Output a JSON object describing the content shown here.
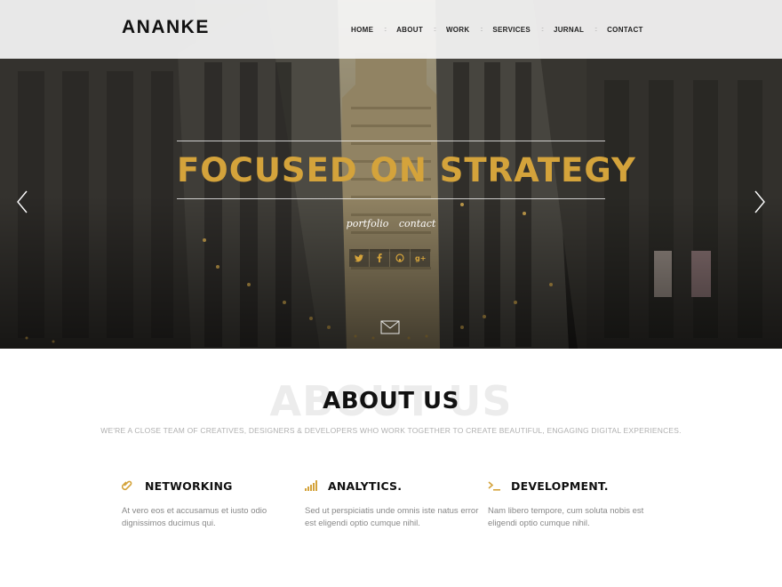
{
  "header": {
    "logo": "ANANKE",
    "nav": [
      {
        "label": "HOME"
      },
      {
        "label": "ABOUT"
      },
      {
        "label": "WORK"
      },
      {
        "label": "SERVICES"
      },
      {
        "label": "JURNAL"
      },
      {
        "label": "CONTACT"
      }
    ],
    "separator": "::"
  },
  "hero": {
    "title": "FOCUSED ON STRATEGY",
    "links": [
      "portfolio",
      "contact"
    ],
    "socials": [
      {
        "icon": "twitter-icon"
      },
      {
        "icon": "facebook-icon"
      },
      {
        "icon": "github-icon"
      },
      {
        "icon": "google-plus-icon"
      }
    ],
    "accent": "#d4a33b"
  },
  "about": {
    "ghost": "ABOUT US",
    "title": "ABOUT US",
    "subtitle": "WE'RE A CLOSE TEAM OF CREATIVES, DESIGNERS & DEVELOPERS WHO WORK TOGETHER TO CREATE BEAUTIFUL, ENGAGING DIGITAL EXPERIENCES.",
    "features": [
      {
        "icon": "paperclip-icon",
        "title": "NETWORKING",
        "text": "At vero eos et accusamus et iusto odio dignissimos ducimus qui."
      },
      {
        "icon": "bar-chart-icon",
        "title": "ANALYTICS.",
        "text": "Sed ut perspiciatis unde omnis iste natus error est eligendi optio cumque nihil."
      },
      {
        "icon": "terminal-icon",
        "title": "DEVELOPMENT.",
        "text": "Nam libero tempore, cum soluta nobis est eligendi optio cumque nihil."
      }
    ]
  }
}
